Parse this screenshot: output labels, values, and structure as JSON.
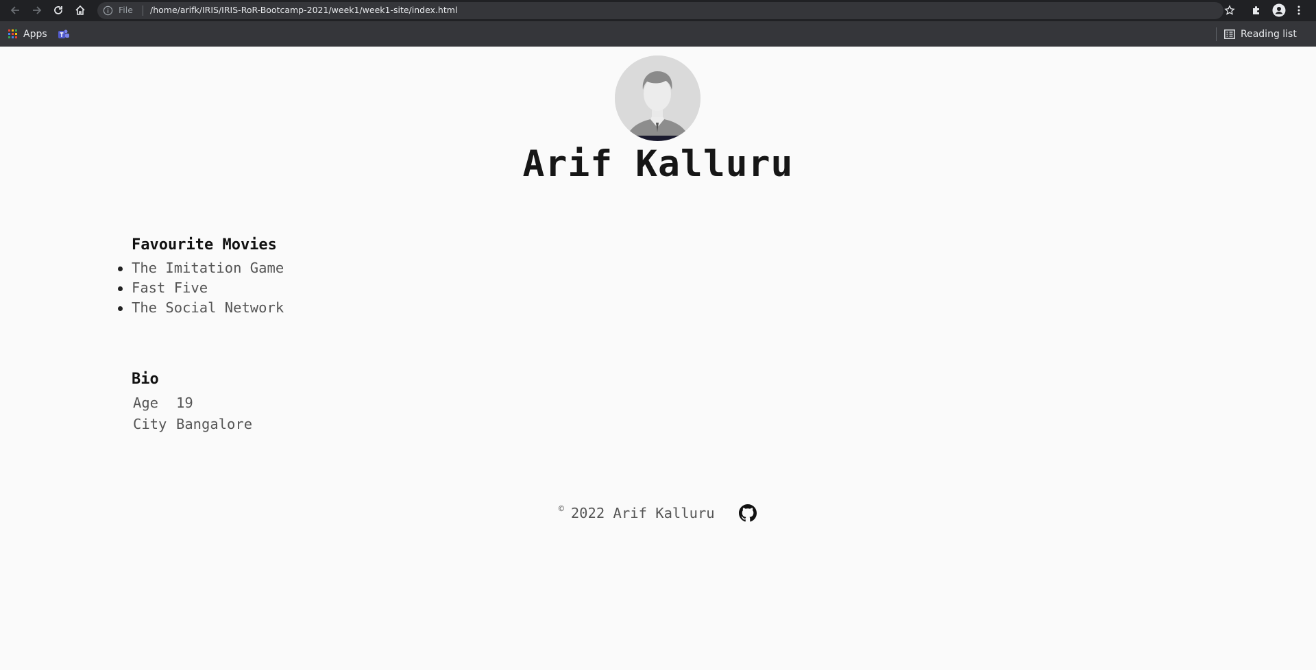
{
  "browser": {
    "url_scheme_label": "File",
    "url": "/home/arifk/IRIS/IRIS-RoR-Bootcamp-2021/week1/week1-site/index.html",
    "bookmarks": [
      {
        "label": "Apps",
        "icon": "apps-grid-icon"
      },
      {
        "label": "",
        "icon": "teams-icon"
      }
    ],
    "reading_list_label": "Reading list"
  },
  "profile": {
    "name": "Arif Kalluru",
    "avatar_icon": "person-silhouette"
  },
  "movies": {
    "heading": "Favourite Movies",
    "items": [
      "The Imitation Game",
      "Fast Five",
      "The Social Network"
    ]
  },
  "bio": {
    "heading": "Bio",
    "rows": [
      {
        "key": "Age",
        "value": "19"
      },
      {
        "key": "City",
        "value": "Bangalore"
      }
    ]
  },
  "footer": {
    "copyright_symbol": "©",
    "text": "2022 Arif Kalluru",
    "icon": "github-icon"
  }
}
